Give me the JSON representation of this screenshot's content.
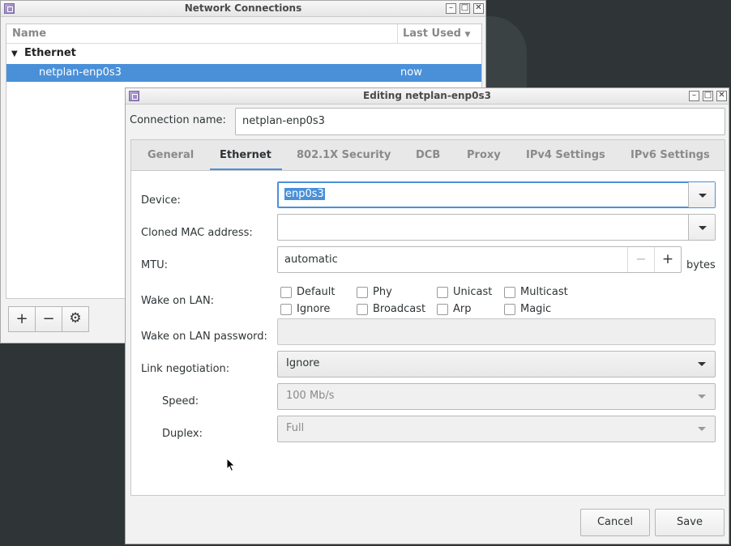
{
  "network_connections": {
    "title": "Network Connections",
    "columns": {
      "name": "Name",
      "last_used": "Last Used"
    },
    "groups": [
      {
        "label": "Ethernet",
        "connections": [
          {
            "name": "netplan-enp0s3",
            "last_used": "now"
          }
        ]
      }
    ],
    "toolbar": {
      "add": "+",
      "remove": "−",
      "settings": "⚙"
    }
  },
  "editor": {
    "title": "Editing netplan-enp0s3",
    "connection_name_label": "Connection name:",
    "connection_name": "netplan-enp0s3",
    "tabs": [
      "General",
      "Ethernet",
      "802.1X Security",
      "DCB",
      "Proxy",
      "IPv4 Settings",
      "IPv6 Settings"
    ],
    "active_tab": "Ethernet",
    "device_label": "Device:",
    "device_value": "enp0s3",
    "cloned_mac_label": "Cloned MAC address:",
    "cloned_mac_value": "",
    "mtu_label": "MTU:",
    "mtu_value": "automatic",
    "mtu_minus": "−",
    "mtu_plus": "+",
    "mtu_unit": "bytes",
    "wol_label": "Wake on LAN:",
    "wol_options": [
      "Default",
      "Phy",
      "Unicast",
      "Multicast",
      "Ignore",
      "Broadcast",
      "Arp",
      "Magic"
    ],
    "wol_password_label": "Wake on LAN password:",
    "link_negotiation_label": "Link negotiation:",
    "link_negotiation_value": "Ignore",
    "speed_label": "Speed:",
    "speed_value": "100 Mb/s",
    "duplex_label": "Duplex:",
    "duplex_value": "Full",
    "cancel_label": "Cancel",
    "save_label": "Save"
  },
  "colors": {
    "accent": "#4a90d9",
    "desktop": "#2f3537",
    "window_bg": "#f2f2f2"
  }
}
